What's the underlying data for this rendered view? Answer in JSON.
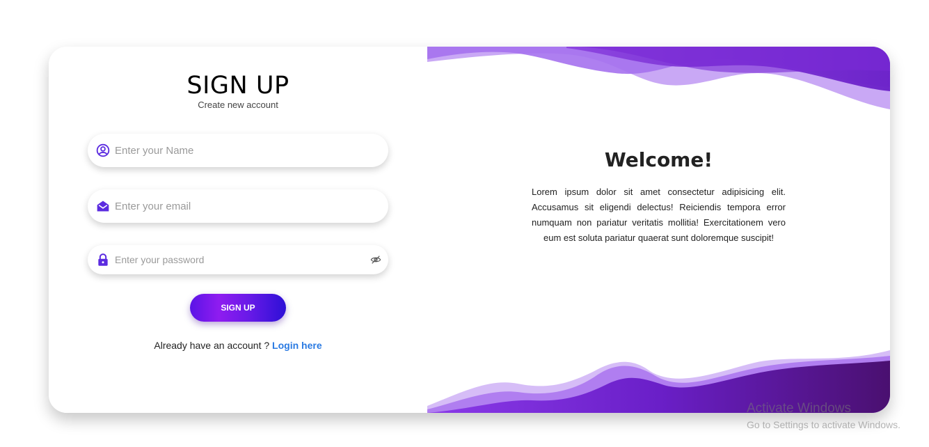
{
  "signup": {
    "title": "SIGN UP",
    "subtitle": "Create new account",
    "name_placeholder": "Enter your Name",
    "email_placeholder": "Enter your email",
    "password_placeholder": "Enter your password",
    "button_label": "SIGN UP",
    "login_prompt": "Already have an account ?",
    "login_link": "Login here"
  },
  "icons": {
    "name": "user-circle-icon",
    "email": "envelope-open-icon",
    "password": "lock-icon",
    "toggle": "eye-slash-icon"
  },
  "welcome": {
    "heading": "Welcome!",
    "body": "Lorem ipsum dolor sit amet consectetur adipisicing elit. Accusamus sit eligendi delectus! Reiciendis tempora error numquam non pariatur veritatis mollitia! Exercitationem vero eum est soluta pariatur quaerat sunt doloremque suscipit!"
  },
  "os_watermark": {
    "line1": "Activate Windows",
    "line2": "Go to Settings to activate Windows."
  },
  "colors": {
    "accent": "#5b2be0",
    "link": "#2a7ae2",
    "wave_dark": "#6a1fd0",
    "wave_light": "#b58af0"
  }
}
